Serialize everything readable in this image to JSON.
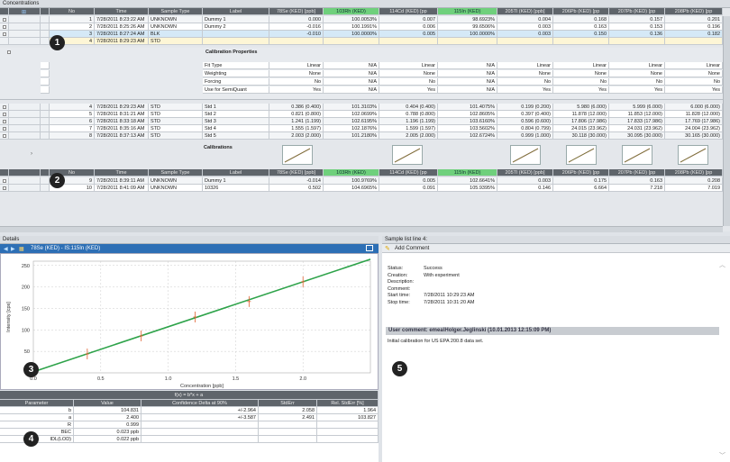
{
  "window": {
    "title": "Concentrations"
  },
  "grid_header": {
    "labels": [
      "No",
      "Time",
      "Sample Type",
      "Label",
      "78Se (KED) [ppb]",
      "103Rh (KED)",
      "114Cd (KED) [pp",
      "115In (KED)",
      "205Tl (KED) [ppb]",
      "206Pb (KED) [pp",
      "207Pb (KED) [pp",
      "208Pb (KED) [pp"
    ]
  },
  "top_rows": [
    [
      "1",
      "7/28/2011 8:23:22 AM",
      "UNKNOWN",
      "Dummy 1",
      "0.000",
      "100.0053%",
      "0.007",
      "98.6923%",
      "0.004",
      "0.168",
      "0.157",
      "0.201"
    ],
    [
      "2",
      "7/28/2011 8:25:26 AM",
      "UNKNOWN",
      "Dummy 2",
      "-0.016",
      "100.1991%",
      "0.006",
      "99.6506%",
      "0.003",
      "0.163",
      "0.153",
      "0.196"
    ],
    [
      "3",
      "7/28/2011 8:27:24 AM",
      "BLK",
      "",
      "-0.010",
      "100.0000%",
      "0.005",
      "100.0000%",
      "0.003",
      "0.150",
      "0.136",
      "0.182"
    ],
    [
      "4",
      "7/28/2011 8:29:23 AM",
      "STD",
      "",
      "",
      "",
      "",
      "",
      "",
      "",
      "",
      ""
    ]
  ],
  "cal_props": {
    "title": "Calibration Properties",
    "rows": [
      {
        "label": "Fit Type",
        "values": [
          "Linear",
          "N/A",
          "Linear",
          "N/A",
          "Linear",
          "Linear",
          "Linear",
          "Linear"
        ]
      },
      {
        "label": "Weighting",
        "values": [
          "None",
          "N/A",
          "None",
          "N/A",
          "None",
          "None",
          "None",
          "None"
        ]
      },
      {
        "label": "Forcing",
        "values": [
          "No",
          "N/A",
          "No",
          "N/A",
          "No",
          "No",
          "No",
          "No"
        ]
      },
      {
        "label": "Use for SemiQuant",
        "values": [
          "Yes",
          "N/A",
          "Yes",
          "N/A",
          "Yes",
          "Yes",
          "Yes",
          "Yes"
        ]
      }
    ]
  },
  "std_rows": [
    [
      "4",
      "7/28/2011 8:29:23 AM",
      "STD",
      "Std 1",
      "0.386 (0.400)",
      "101.3103%",
      "0.404 (0.400)",
      "101.4075%",
      "0.199 (0.200)",
      "5.980 (6.000)",
      "5.999 (6.000)",
      "6.000 (6.000)"
    ],
    [
      "5",
      "7/28/2011 8:31:21 AM",
      "STD",
      "Std 2",
      "0.821 (0.800)",
      "102.0699%",
      "0.788 (0.800)",
      "102.8605%",
      "0.397 (0.400)",
      "11.878 (12.000)",
      "11.853 (12.000)",
      "11.828 (12.000)"
    ],
    [
      "6",
      "7/28/2011 8:33:18 AM",
      "STD",
      "Std 3",
      "1.241 (1.199)",
      "102.6195%",
      "1.196 (1.199)",
      "103.6160%",
      "0.596 (0.600)",
      "17.806 (17.986)",
      "17.833 (17.986)",
      "17.769 (17.986)"
    ],
    [
      "7",
      "7/28/2011 8:35:16 AM",
      "STD",
      "Std 4",
      "1.555 (1.597)",
      "102.1876%",
      "1.599 (1.597)",
      "103.5602%",
      "0.804 (0.799)",
      "24.015 (23.962)",
      "24.031 (23.962)",
      "24.004 (23.962)"
    ],
    [
      "8",
      "7/28/2011 8:37:13 AM",
      "STD",
      "Std 5",
      "2.003 (2.000)",
      "101.2180%",
      "2.005 (2.000)",
      "102.6724%",
      "0.999 (1.000)",
      "30.118 (30.000)",
      "30.095 (30.000)",
      "30.165 (30.000)"
    ]
  ],
  "calibrations_label": "Calibrations",
  "bottom_rows": [
    [
      "9",
      "7/28/2011 8:39:11 AM",
      "UNKNOWN",
      "Dummy 1",
      "-0.014",
      "100.9769%",
      "0.005",
      "102.6641%",
      "0.003",
      "0.175",
      "0.163",
      "0.208"
    ],
    [
      "10",
      "7/28/2011 8:41:09 AM",
      "UNKNOWN",
      "10326",
      "0.502",
      "104.6965%",
      "0.091",
      "105.9395%",
      "0.146",
      "6.664",
      "7.218",
      "7.019"
    ]
  ],
  "details": {
    "pane_title": "Details",
    "chart_title": "78Se (KED) - IS:115In (KED)"
  },
  "chart_data": {
    "type": "scatter",
    "xlabel": "Concentration [ppb]",
    "ylabel": "Intensity [cps]",
    "xlim": [
      0,
      2.5
    ],
    "ylim": [
      0,
      260
    ],
    "xticks": [
      "0.0",
      "0.5",
      "1.0",
      "1.5",
      "2.0"
    ],
    "yticks": [
      "50",
      "100",
      "150",
      "200",
      "250"
    ],
    "points": [
      {
        "x": 0.0,
        "y": 2.4
      },
      {
        "x": 0.4,
        "y": 44
      },
      {
        "x": 0.8,
        "y": 86
      },
      {
        "x": 1.2,
        "y": 130
      },
      {
        "x": 1.6,
        "y": 166
      },
      {
        "x": 2.0,
        "y": 212
      }
    ],
    "fit_line": {
      "slope": 104.831,
      "intercept": 2.4
    },
    "grid": true
  },
  "fit_table": {
    "formula": "f(x) = b*x + a",
    "headers": [
      "Parameter",
      "Value",
      "Confidence Delta at 90%",
      "StdErr",
      "Rel. StdErr [%]"
    ],
    "rows": [
      [
        "b",
        "104.831",
        "+/-2.964",
        "2.058",
        "1.964"
      ],
      [
        "a",
        "2.400",
        "+/-3.587",
        "2.491",
        "103.827"
      ],
      [
        "R",
        "0.999",
        "",
        "",
        ""
      ],
      [
        "BEC",
        "0.023 ppb",
        "",
        "",
        ""
      ],
      [
        "IDL(LOD)",
        "0.022 ppb",
        "",
        "",
        ""
      ]
    ]
  },
  "sample_info": {
    "pane_title": "Sample list line 4:",
    "add_comment": "Add Comment",
    "fields": [
      {
        "k": "Status:",
        "v": "Success"
      },
      {
        "k": "Creation:",
        "v": "With experiment"
      },
      {
        "k": "Description:",
        "v": ""
      },
      {
        "k": "Comment:",
        "v": ""
      },
      {
        "k": "Start time:",
        "v": "7/28/2011 10:29:23 AM"
      },
      {
        "k": "Stop time:",
        "v": "7/28/2011 10:31:20 AM"
      }
    ],
    "user_comment": "User comment: emea\\Holger.Jeglinski (10.01.2013 12:15:09 PM)",
    "comment_text": "Initial calibration for US EPA 200.8 data set."
  },
  "callouts": [
    "1",
    "2",
    "3",
    "4",
    "5"
  ]
}
